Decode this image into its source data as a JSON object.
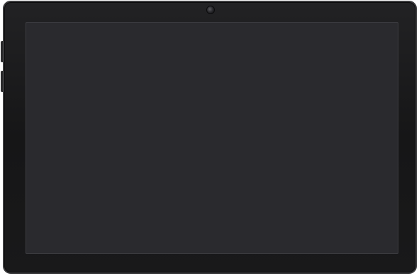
{
  "device": {
    "type": "tablet",
    "orientation": "landscape",
    "screen_state": "off",
    "colors": {
      "bezel": "#1a1a1b",
      "bezel_edge": "#3a3a3c",
      "screen": "#2a2a2e"
    }
  },
  "icons": [
    "front-camera-icon"
  ]
}
